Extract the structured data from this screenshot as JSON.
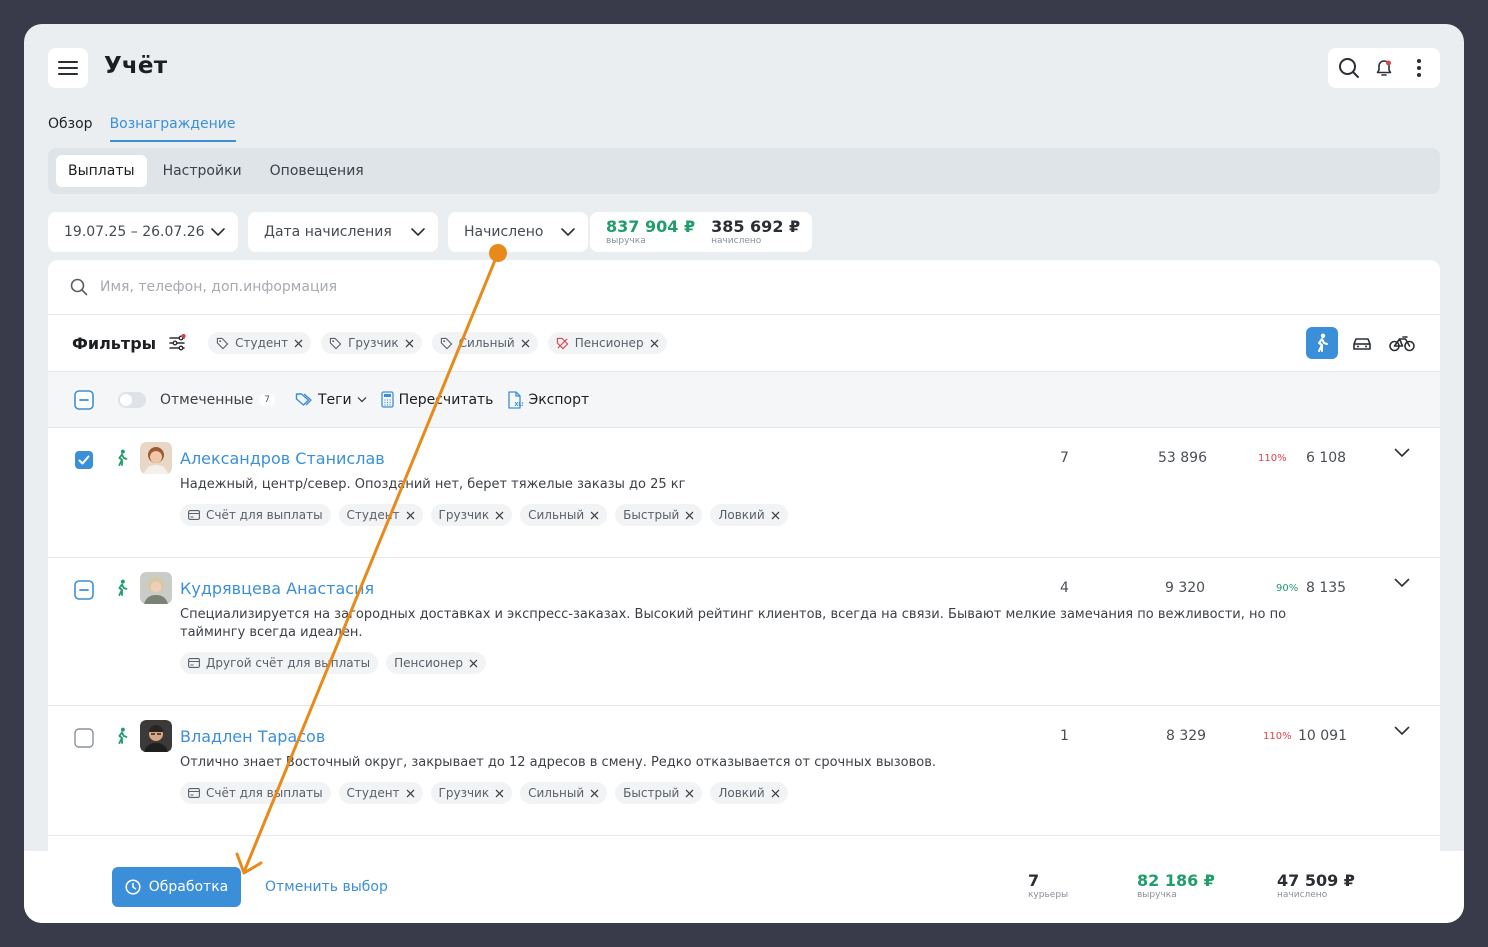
{
  "header": {
    "title": "Учёт"
  },
  "tabs": [
    {
      "label": "Обзор"
    },
    {
      "label": "Вознаграждение"
    }
  ],
  "subtabs": [
    {
      "label": "Выплаты"
    },
    {
      "label": "Настройки"
    },
    {
      "label": "Оповещения"
    }
  ],
  "filterbar": {
    "date_range": "19.07.25 – 26.07.26",
    "date_type": "Дата начисления",
    "status": "Начислено",
    "revenue_value": "837 904 ₽",
    "revenue_label": "выручка",
    "accrued_value": "385 692 ₽",
    "accrued_label": "начислено"
  },
  "search": {
    "placeholder": "Имя, телефон, доп.информация"
  },
  "filters": {
    "label": "Фильтры",
    "chips": [
      "Студент",
      "Грузчик",
      "Сильный",
      "Пенсионер"
    ]
  },
  "actions": {
    "marked_label": "Отмеченные",
    "marked_count": "7",
    "tags_label": "Теги",
    "recalc_label": "Пересчитать",
    "export_label": "Экспорт"
  },
  "rows": [
    {
      "name": "Александров Станислав",
      "description": "Надежный, центр/север. Опозданий нет, берет тяжелые заказы до 25 кг",
      "account": "Счёт для выплаты",
      "tags": [
        "Студент",
        "Грузчик",
        "Сильный",
        "Быстрый",
        "Ловкий"
      ],
      "orders": "7",
      "revenue": "53 896",
      "percent": "110%",
      "accrued": "6 108"
    },
    {
      "name": "Кудрявцева Анастасия",
      "description": "Специализируется на загородных доставках и экспресс-заказах. Высокий рейтинг клиентов, всегда на связи. Бывают мелкие замечания по вежливости, но по таймингу всегда идеален.",
      "account": "Другой счёт для выплаты",
      "tags": [
        "Пенсионер"
      ],
      "orders": "4",
      "revenue": "9 320",
      "percent": "90%",
      "accrued": "8 135"
    },
    {
      "name": "Владлен Тарасов",
      "description": "Отлично знает Восточный округ, закрывает до 12 адресов в смену. Редко отказывается от срочных вызовов.",
      "account": "Счёт для выплаты",
      "tags": [
        "Студент",
        "Грузчик",
        "Сильный",
        "Быстрый",
        "Ловкий"
      ],
      "orders": "1",
      "revenue": "8 329",
      "percent": "110%",
      "accrued": "10 091"
    }
  ],
  "footer": {
    "process_label": "Обработка",
    "cancel_label": "Отменить выбор",
    "couriers_value": "7",
    "couriers_label": "курьеры",
    "revenue_value": "82 186 ₽",
    "revenue_label": "выручка",
    "accrued_value": "47 509 ₽",
    "accrued_label": "начислено"
  },
  "colors": {
    "accent": "#3b8fd9",
    "positive": "#1f9d6b",
    "negative": "#d9434b",
    "annotation_arrow": "#e88a1a"
  },
  "icons": [
    "menu-icon",
    "search-icon",
    "bell-icon",
    "more-vertical-icon",
    "chevron-down-icon",
    "filter-settings-icon",
    "tag-icon",
    "walker-icon",
    "car-icon",
    "bicycle-icon",
    "calculator-icon",
    "xls-file-icon",
    "card-icon",
    "close-icon",
    "clock-icon"
  ]
}
